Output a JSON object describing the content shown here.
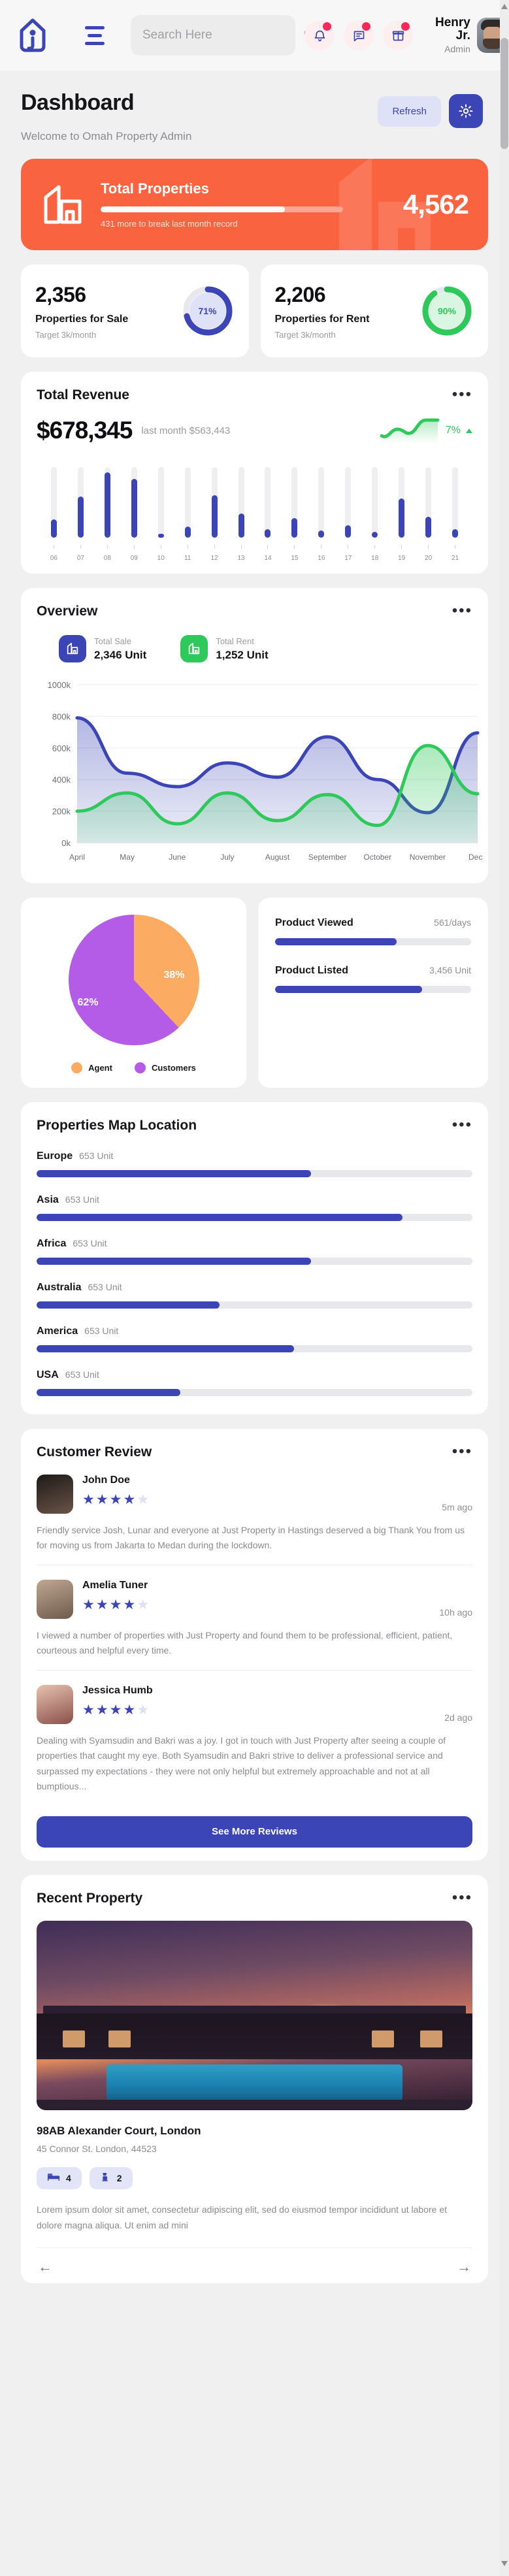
{
  "header": {
    "logo_icon": "home-logo-icon",
    "menu_icon": "hamburger-menu-icon",
    "search": {
      "placeholder": "Search Here",
      "value": "",
      "icon": "search-icon"
    },
    "icons": [
      {
        "name": "bell-icon",
        "badge": true
      },
      {
        "name": "message-icon",
        "badge": true
      },
      {
        "name": "gift-icon",
        "badge": true
      }
    ],
    "user": {
      "name": "Henry Jr.",
      "role": "Admin",
      "avatar": "user-avatar"
    }
  },
  "page": {
    "title": "Dashboard",
    "subtitle": "Welcome to Omah Property Admin",
    "refresh_label": "Refresh",
    "settings_icon": "gear-icon"
  },
  "total_properties": {
    "title": "Total Properties",
    "value": "4,562",
    "note": "431 more to break last month record",
    "progress_pct": 76,
    "icon": "building-icon",
    "color": "#fa6340"
  },
  "stats": [
    {
      "value": "2,356",
      "label": "Properties for Sale",
      "target": "Target 3k/month",
      "pct": "71%",
      "pct_value": 71,
      "color": "#3b45b5",
      "track": "#e6e6ea",
      "fill": "#dfe1f7"
    },
    {
      "value": "2,206",
      "label": "Properties for Rent",
      "target": "Target 3k/month",
      "pct": "90%",
      "pct_value": 90,
      "color": "#2fc95b",
      "track": "#e6e6ea",
      "fill": "#d9f6e2"
    }
  ],
  "revenue": {
    "title": "Total Revenue",
    "amount": "$678,345",
    "last_month": "last month $563,443",
    "change_pct": "7%",
    "trend": "up",
    "menu_icon": "more-dots-icon"
  },
  "overview": {
    "title": "Overview",
    "menu_icon": "more-dots-icon",
    "items": [
      {
        "label": "Total Sale",
        "value": "2,346 Unit",
        "color": "#3b45b5",
        "icon": "building-icon"
      },
      {
        "label": "Total Rent",
        "value": "1,252 Unit",
        "color": "#2fc95b",
        "icon": "building-icon"
      }
    ]
  },
  "pie": {
    "legend": [
      {
        "label": "Agent",
        "color": "#fbab62",
        "value": 38,
        "display": "38%"
      },
      {
        "label": "Customers",
        "color": "#b45ce8",
        "value": 62,
        "display": "62%"
      }
    ]
  },
  "products": [
    {
      "name": "Product Viewed",
      "value": "561/days",
      "pct": 62
    },
    {
      "name": "Product Listed",
      "value": "3,456 Unit",
      "pct": 75
    }
  ],
  "map_location": {
    "title": "Properties Map Location",
    "menu_icon": "more-dots-icon",
    "unit_suffix": "653 Unit",
    "rows": [
      {
        "name": "Europe",
        "value": "653 Unit",
        "pct": 63
      },
      {
        "name": "Asia",
        "value": "653 Unit",
        "pct": 84
      },
      {
        "name": "Africa",
        "value": "653 Unit",
        "pct": 63
      },
      {
        "name": "Australia",
        "value": "653 Unit",
        "pct": 42
      },
      {
        "name": "America",
        "value": "653 Unit",
        "pct": 59
      },
      {
        "name": "USA",
        "value": "653 Unit",
        "pct": 33
      }
    ]
  },
  "customer_review": {
    "title": "Customer Review",
    "menu_icon": "more-dots-icon",
    "see_more_label": "See More Reviews",
    "reviews": [
      {
        "name": "John Doe",
        "stars": 4,
        "max_stars": 5,
        "time": "5m ago",
        "text": "Friendly service Josh, Lunar and everyone at Just Property in Hastings deserved a big Thank You from us for moving us from Jakarta to Medan during the lockdown."
      },
      {
        "name": "Amelia Tuner",
        "stars": 4,
        "max_stars": 5,
        "time": "10h ago",
        "text": "I viewed a number of properties with Just Property and found them to be professional, efficient, patient, courteous and helpful every time."
      },
      {
        "name": "Jessica Humb",
        "stars": 4,
        "max_stars": 5,
        "time": "2d ago",
        "text": "Dealing with Syamsudin and Bakri was a joy. I got in touch with Just Property after seeing a couple of properties that caught my eye. Both Syamsudin and Bakri strive to deliver a professional service and surpassed my expectations - they were not only helpful but extremely approachable and not at all bumptious..."
      }
    ]
  },
  "recent_property": {
    "title": "Recent Property",
    "menu_icon": "more-dots-icon",
    "image_alt": "modern-house-at-sunset-with-pool",
    "name": "98AB Alexander Court, London",
    "address": "45 Connor St. London, 44523",
    "features": [
      {
        "icon": "bed-icon",
        "count": "4"
      },
      {
        "icon": "bath-icon",
        "count": "2"
      }
    ],
    "description": "Lorem ipsum dolor sit amet, consectetur adipiscing elit, sed do eiusmod tempor incididunt ut labore et dolore magna aliqua. Ut enim ad mini",
    "prev_icon": "arrow-left-icon",
    "next_icon": "arrow-right-icon"
  },
  "chart_data": [
    {
      "type": "bar",
      "title": "Total Revenue",
      "categories": [
        "06",
        "07",
        "08",
        "09",
        "10",
        "11",
        "12",
        "13",
        "14",
        "15",
        "16",
        "17",
        "18",
        "19",
        "20",
        "21"
      ],
      "values": [
        26,
        58,
        93,
        83,
        6,
        16,
        60,
        34,
        12,
        28,
        10,
        18,
        8,
        56,
        30,
        12
      ],
      "ylim": [
        0,
        100
      ],
      "xlabel": "",
      "ylabel": "",
      "grid": false
    },
    {
      "type": "area",
      "title": "Overview",
      "categories": [
        "April",
        "May",
        "June",
        "July",
        "August",
        "September",
        "October",
        "November",
        "Dec.."
      ],
      "x": [
        "April",
        "May",
        "June",
        "July",
        "August",
        "September",
        "October",
        "November",
        "Dec.."
      ],
      "series": [
        {
          "name": "Total Sale",
          "color": "#3b45b5",
          "values": [
            790,
            440,
            355,
            505,
            415,
            670,
            400,
            190,
            695
          ]
        },
        {
          "name": "Total Rent",
          "color": "#2fc95b",
          "values": [
            200,
            315,
            120,
            315,
            140,
            305,
            110,
            615,
            310
          ]
        }
      ],
      "yticks": [
        "0k",
        "200k",
        "400k",
        "600k",
        "800k",
        "1000k"
      ],
      "ylim": [
        0,
        1000
      ],
      "ylabel": "",
      "xlabel": "",
      "grid": true,
      "legend": "none"
    },
    {
      "type": "pie",
      "title": "",
      "labels": [
        "Agent",
        "Customers"
      ],
      "values": [
        38,
        62
      ],
      "colors": [
        "#fbab62",
        "#b45ce8"
      ],
      "legend": "bottom"
    },
    {
      "type": "bar",
      "title": "Properties Map Location",
      "orientation": "horizontal",
      "categories": [
        "Europe",
        "Asia",
        "Africa",
        "Australia",
        "America",
        "USA"
      ],
      "values": [
        63,
        84,
        63,
        42,
        59,
        33
      ],
      "value_labels": [
        "653 Unit",
        "653 Unit",
        "653 Unit",
        "653 Unit",
        "653 Unit",
        "653 Unit"
      ],
      "ylim": [
        0,
        100
      ],
      "grid": false
    }
  ]
}
